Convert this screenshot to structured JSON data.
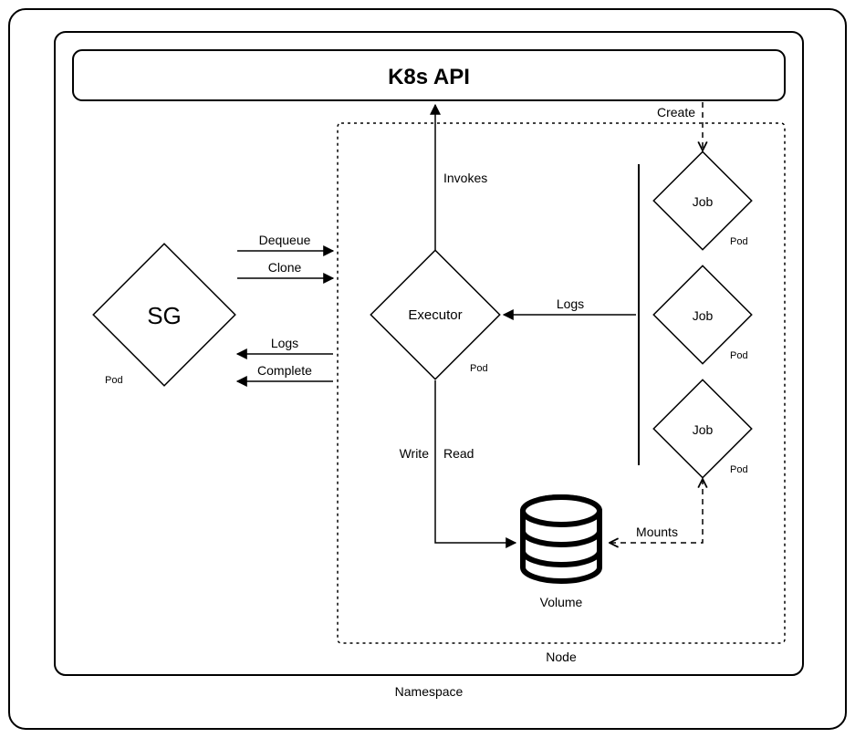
{
  "diagram": {
    "outer_frame": "",
    "namespace_label": "Namespace",
    "api_title": "K8s API",
    "node_label": "Node",
    "sg": {
      "name": "SG",
      "pod_label": "Pod"
    },
    "executor": {
      "name": "Executor",
      "pod_label": "Pod"
    },
    "jobs": [
      {
        "name": "Job",
        "pod_label": "Pod"
      },
      {
        "name": "Job",
        "pod_label": "Pod"
      },
      {
        "name": "Job",
        "pod_label": "Pod"
      }
    ],
    "volume_label": "Volume",
    "arrows": {
      "dequeue": "Dequeue",
      "clone": "Clone",
      "logs_to_sg": "Logs",
      "complete": "Complete",
      "invokes": "Invokes",
      "create": "Create",
      "logs_to_executor": "Logs",
      "write": "Write",
      "read": "Read",
      "mounts": "Mounts"
    }
  }
}
